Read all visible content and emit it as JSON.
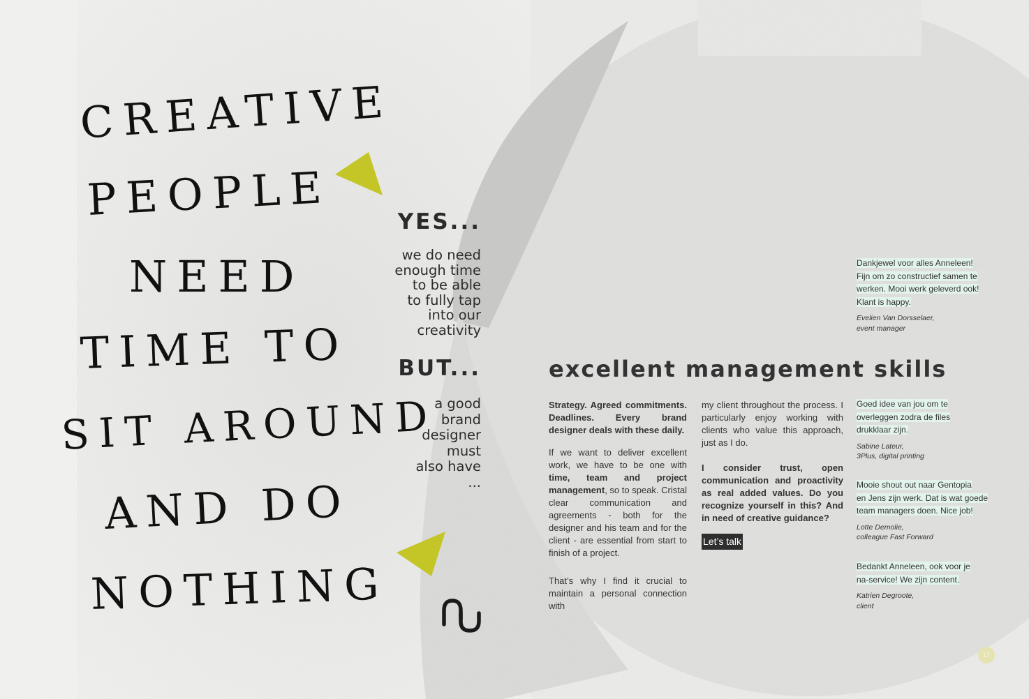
{
  "handwritten": {
    "line1": "CREATIVE",
    "line2": "PEOPLE",
    "line3": "NEED",
    "line4": "TIME TO",
    "line5": "SIT AROUND",
    "line6": "AND DO",
    "line7": "NOTHING"
  },
  "middle": {
    "yes": "YES...",
    "yes_body": [
      "we do need",
      "enough time",
      "to be able",
      "to fully tap",
      "into our",
      "creativity"
    ],
    "but": "BUT...",
    "but_body": [
      "a good",
      "brand",
      "designer",
      "must",
      "also have",
      "..."
    ]
  },
  "colors": {
    "accent_triangle": "#c4c526",
    "quote_highlight": "#e2f3ec",
    "button_bg": "#2e2e2e",
    "page_circle": "#e5e3b2"
  },
  "heading": "excellent management skills",
  "col1": {
    "p1": "Strategy. Agreed commitments. Deadlines. Every brand designer deals with these daily.",
    "p2_pre": "If we want to deliver excellent work, we have to be one with ",
    "p2_bold": "time, team and project management",
    "p2_post": ", so to speak. Cristal clear communication and agreements - both for the designer and his team and for the client - are essential from start to finish of a project.",
    "p3": "That’s why I find it crucial to maintain a personal connection with"
  },
  "col2": {
    "p1": "my client throughout the process. I particularly enjoy working with clients who value this approach, just as I do.",
    "p2": "I consider trust, open communication and proactivity as real added values. Do you recognize yourself in this? And in need of creative guidance?",
    "cta": "Let’s talk"
  },
  "quotes": [
    {
      "text": [
        "Dankjewel voor alles Anneleen!",
        "Fijn om zo constructief samen te",
        "werken. Mooi werk geleverd ook!",
        "Klant is happy."
      ],
      "name": "Evelien Van Dorsselaer,",
      "role": "event manager"
    },
    {
      "text": [
        "Goed idee van jou om te",
        "overleggen zodra de files",
        "drukklaar zijn."
      ],
      "name": "Sabine Lateur,",
      "role": "3Plus, digital printing"
    },
    {
      "text": [
        "Mooie shout out naar Gentopia",
        "en Jens zijn werk. Dat is wat goede",
        "team managers doen. Nice job!"
      ],
      "name": "Lotte Demolie,",
      "role": "colleague Fast Forward"
    },
    {
      "text": [
        "Bedankt Anneleen, ook voor je",
        "na-service! We zijn content."
      ],
      "name": "Katrien Degroote,",
      "role": "client"
    }
  ],
  "page_number": "17"
}
